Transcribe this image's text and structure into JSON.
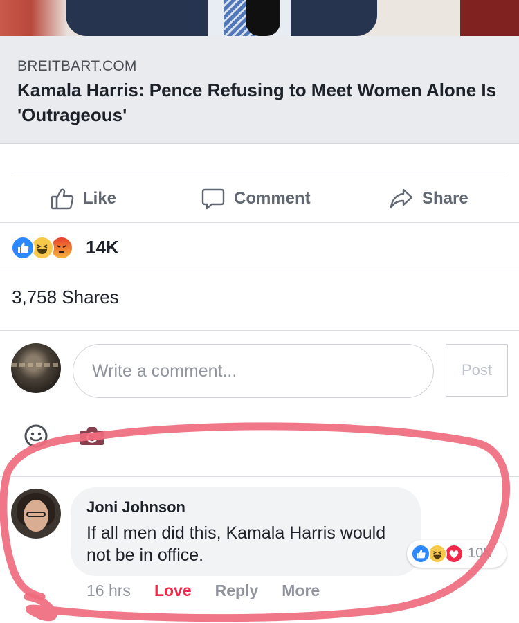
{
  "link_preview": {
    "domain": "BREITBART.COM",
    "title": "Kamala Harris: Pence Refusing to Meet Women Alone Is 'Outrageous'"
  },
  "actions": {
    "like_label": "Like",
    "comment_label": "Comment",
    "share_label": "Share"
  },
  "post_stats": {
    "reactions": [
      "like",
      "haha",
      "angry"
    ],
    "reaction_count": "14K",
    "shares": "3,758 Shares"
  },
  "composer": {
    "placeholder": "Write a comment...",
    "post_label": "Post",
    "tools": [
      "emoji-icon",
      "camera-icon"
    ]
  },
  "comment": {
    "author": "Joni Johnson",
    "text": "If all men did this, Kamala Harris would not be in office.",
    "reactions": [
      "like",
      "haha",
      "love"
    ],
    "reaction_count": "10K",
    "time": "16 hrs",
    "love_label": "Love",
    "reply_label": "Reply",
    "more_label": "More"
  },
  "colors": {
    "facebook_blue": "#2d88ff",
    "love_red": "#f0284a",
    "highlight_pink": "#ef6b7e",
    "text_gray": "#606770",
    "meta_gray": "#90949c"
  }
}
